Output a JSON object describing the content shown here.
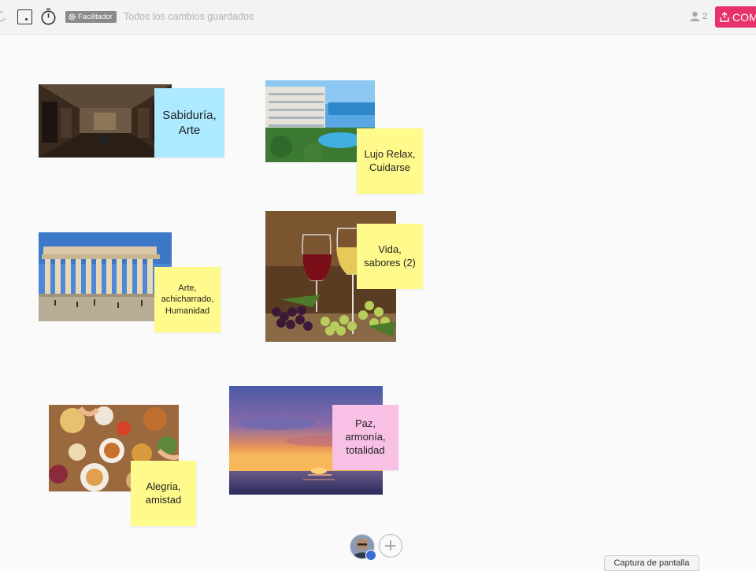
{
  "toolbar": {
    "undo_icon": "undo-icon",
    "frame_icon": "frame-icon",
    "timer_icon": "timer-icon",
    "facilitator_label": "Facilitador",
    "save_status": "Todos los cambios guardados",
    "user_count": "2",
    "share_label": "COM",
    "share_color": "#e8326b"
  },
  "board": {
    "notes": [
      {
        "text": "Sabiduría, Arte",
        "color": "#aeeaff"
      },
      {
        "text": "Lujo Relax, Cuidarse",
        "color": "#fffa8c"
      },
      {
        "text": "Arte, achicharrado, Humanidad",
        "color": "#fffa8c"
      },
      {
        "text": "Vida, sabores (2)",
        "color": "#fffa8c"
      },
      {
        "text": "Alegria, amistad",
        "color": "#fffa8c"
      },
      {
        "text": "Paz, armonía, totalidad",
        "color": "#f9c0e6"
      }
    ],
    "images": [
      "museum-gallery-photo",
      "resort-pool-photo",
      "parthenon-photo",
      "wine-grapes-photo",
      "food-table-photo",
      "sunset-sea-photo"
    ]
  },
  "footer": {
    "avatar": "user-avatar",
    "add_icon": "add-icon",
    "screenshot_label": "Captura de pantalla"
  }
}
